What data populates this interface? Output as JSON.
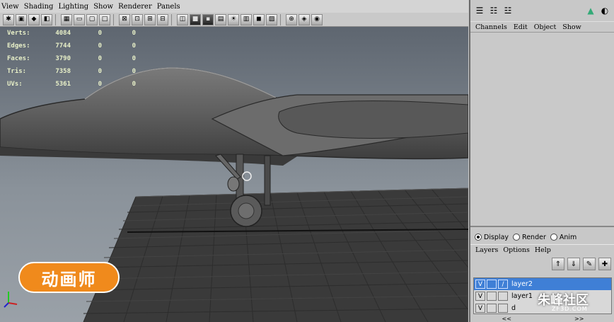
{
  "viewport": {
    "menu": [
      "View",
      "Shading",
      "Lighting",
      "Show",
      "Renderer",
      "Panels"
    ],
    "hud": [
      {
        "label": "Verts:",
        "v1": "4084",
        "v2": "0",
        "v3": "0"
      },
      {
        "label": "Edges:",
        "v1": "7744",
        "v2": "0",
        "v3": "0"
      },
      {
        "label": "Faces:",
        "v1": "3790",
        "v2": "0",
        "v3": "0"
      },
      {
        "label": "Tris:",
        "v1": "7358",
        "v2": "0",
        "v3": "0"
      },
      {
        "label": "UVs:",
        "v1": "5361",
        "v2": "0",
        "v3": "0"
      }
    ],
    "logo_text": "动画师"
  },
  "channel_box": {
    "menu": [
      "Channels",
      "Edit",
      "Object",
      "Show"
    ]
  },
  "layer_editor": {
    "modes": {
      "display": "Display",
      "render": "Render",
      "anim": "Anim"
    },
    "menu": [
      "Layers",
      "Options",
      "Help"
    ],
    "layers": [
      {
        "v": "V",
        "name": "layer2",
        "selected": true
      },
      {
        "v": "V",
        "name": "layer1",
        "selected": false
      },
      {
        "v": "V",
        "name": "d",
        "selected": false
      }
    ],
    "footer": {
      "prev": "<<",
      "next": ">>"
    }
  },
  "watermark": {
    "title": "朱峰社区",
    "sub": "ZF3D.COM"
  },
  "colors": {
    "viewport_bg": "#b9b9b9",
    "selection": "#3f7fd6",
    "logo": "#f08a1c"
  }
}
